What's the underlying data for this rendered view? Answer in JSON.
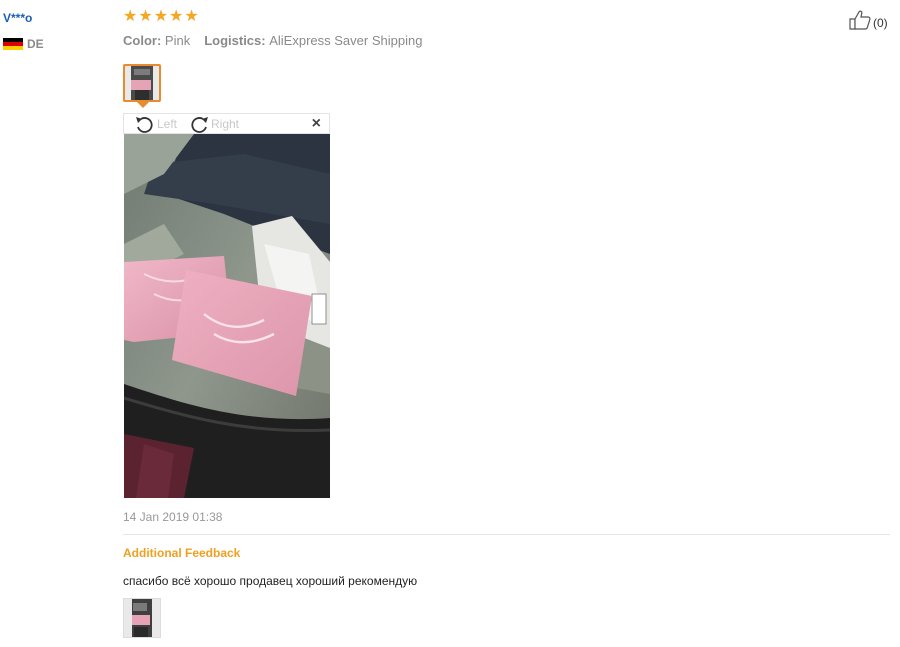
{
  "user": {
    "name": "V***o",
    "country_code": "DE",
    "flag_colors": [
      "#000000",
      "#dd0000",
      "#ffce00"
    ]
  },
  "review": {
    "rating": 5,
    "stars": [
      "★",
      "★",
      "★",
      "★",
      "★"
    ],
    "star_color": "#f5a623",
    "color_label": "Color:",
    "color_value": "Pink",
    "logistics_label": "Logistics:",
    "logistics_value": "AliExpress Saver Shipping",
    "helpful_count": "(0)",
    "date": "14 Jan 2019 01:38"
  },
  "viewer": {
    "rotate_left_label": "Left",
    "rotate_right_label": "Right",
    "close_icon": "close-icon"
  },
  "additional_feedback": {
    "title": "Additional Feedback",
    "text": "спасибо всё хорошо продавец хороший рекомендую"
  },
  "colors": {
    "accent": "#f0a020",
    "thumb_border": "#e88a2e",
    "username": "#1a5fb4"
  }
}
